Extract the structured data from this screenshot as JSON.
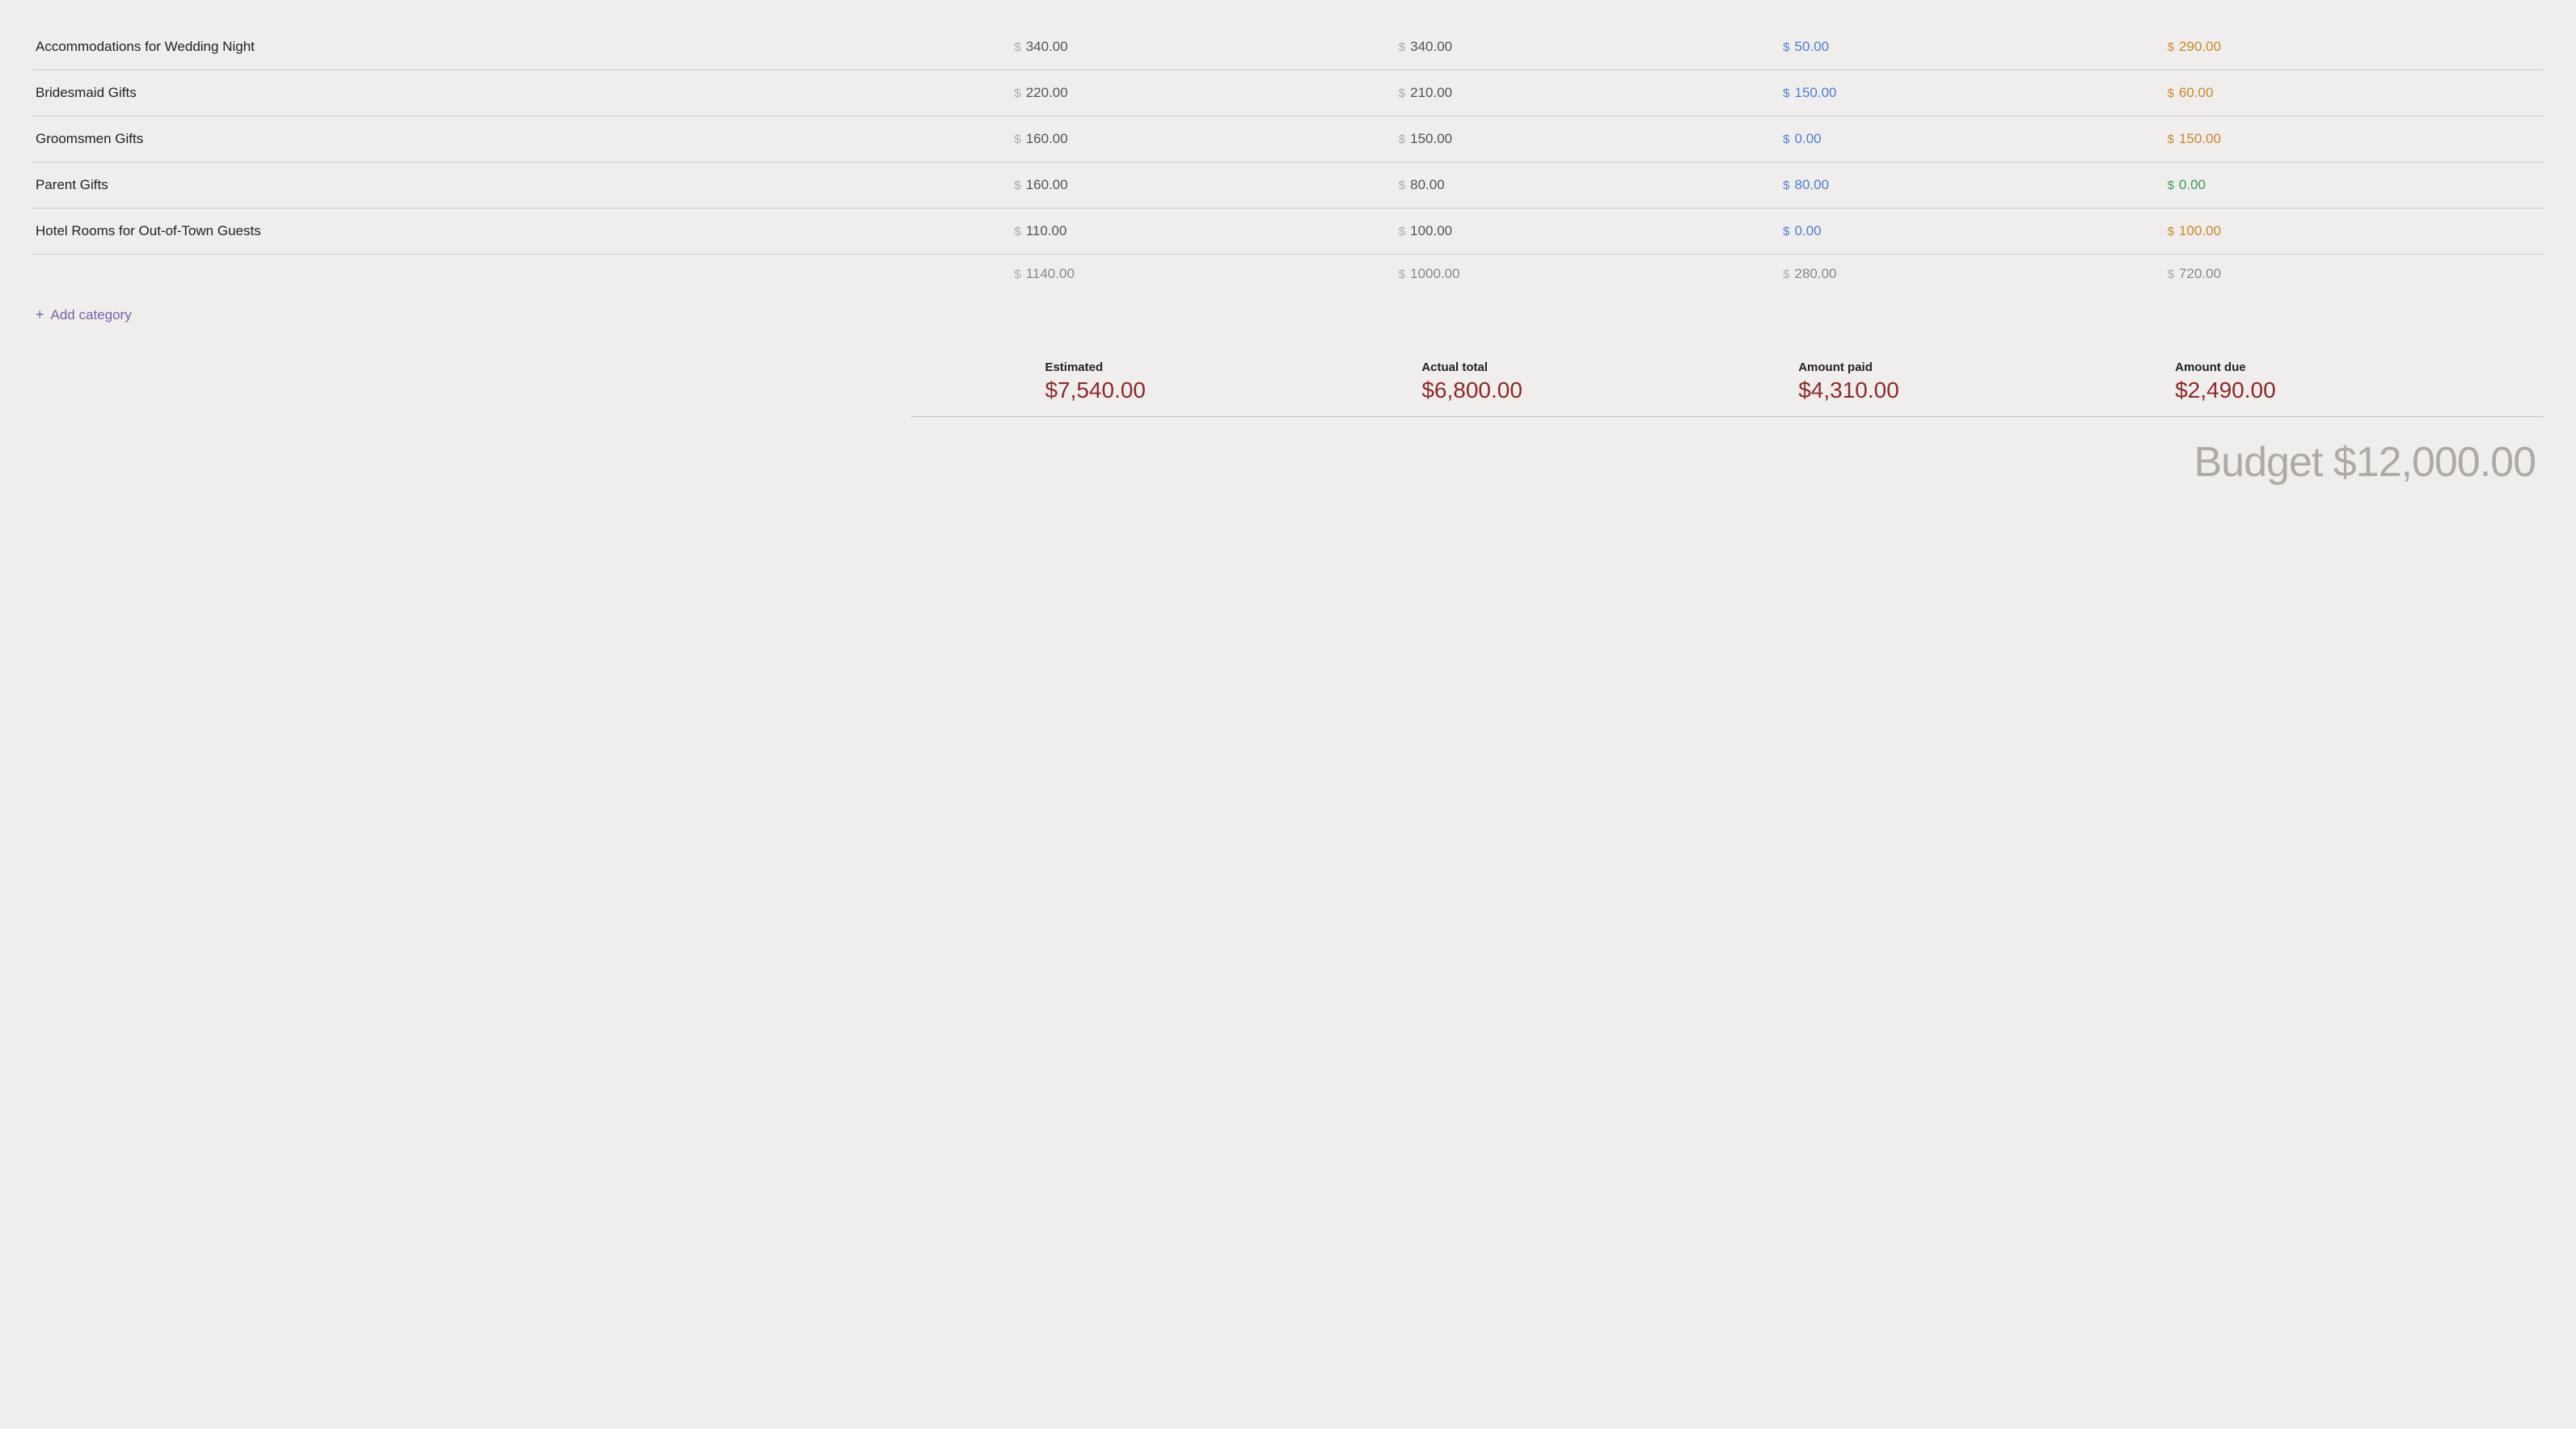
{
  "items": [
    {
      "name": "Accommodations for Wedding Night",
      "estimated": "340.00",
      "actual": "340.00",
      "paid": "50.00",
      "due": "290.00",
      "paid_color": "blue",
      "due_color": "orange"
    },
    {
      "name": "Bridesmaid Gifts",
      "estimated": "220.00",
      "actual": "210.00",
      "paid": "150.00",
      "due": "60.00",
      "paid_color": "blue",
      "due_color": "orange"
    },
    {
      "name": "Groomsmen Gifts",
      "estimated": "160.00",
      "actual": "150.00",
      "paid": "0.00",
      "due": "150.00",
      "paid_color": "blue",
      "due_color": "orange"
    },
    {
      "name": "Parent Gifts",
      "estimated": "160.00",
      "actual": "80.00",
      "paid": "80.00",
      "due": "0.00",
      "paid_color": "blue",
      "due_color": "green"
    },
    {
      "name": "Hotel Rooms for Out-of-Town Guests",
      "estimated": "110.00",
      "actual": "100.00",
      "paid": "0.00",
      "due": "100.00",
      "paid_color": "blue",
      "due_color": "orange"
    }
  ],
  "subtotals": {
    "estimated": "1140.00",
    "actual": "1000.00",
    "paid": "280.00",
    "due": "720.00"
  },
  "add_category_label": "Add category",
  "summary": {
    "estimated_label": "Estimated",
    "estimated_total": "$7,540.00",
    "actual_label": "Actual total",
    "actual_total": "$6,800.00",
    "paid_label": "Amount paid",
    "paid_total": "$4,310.00",
    "due_label": "Amount due",
    "due_total": "$2,490.00"
  },
  "budget_label": "Budget $12,000.00",
  "colors": {
    "blue": "#4a7fd4",
    "orange": "#c8882a",
    "green": "#3a9a5c",
    "purple": "#7b5ea7",
    "dark_red": "#8b2a2a"
  }
}
